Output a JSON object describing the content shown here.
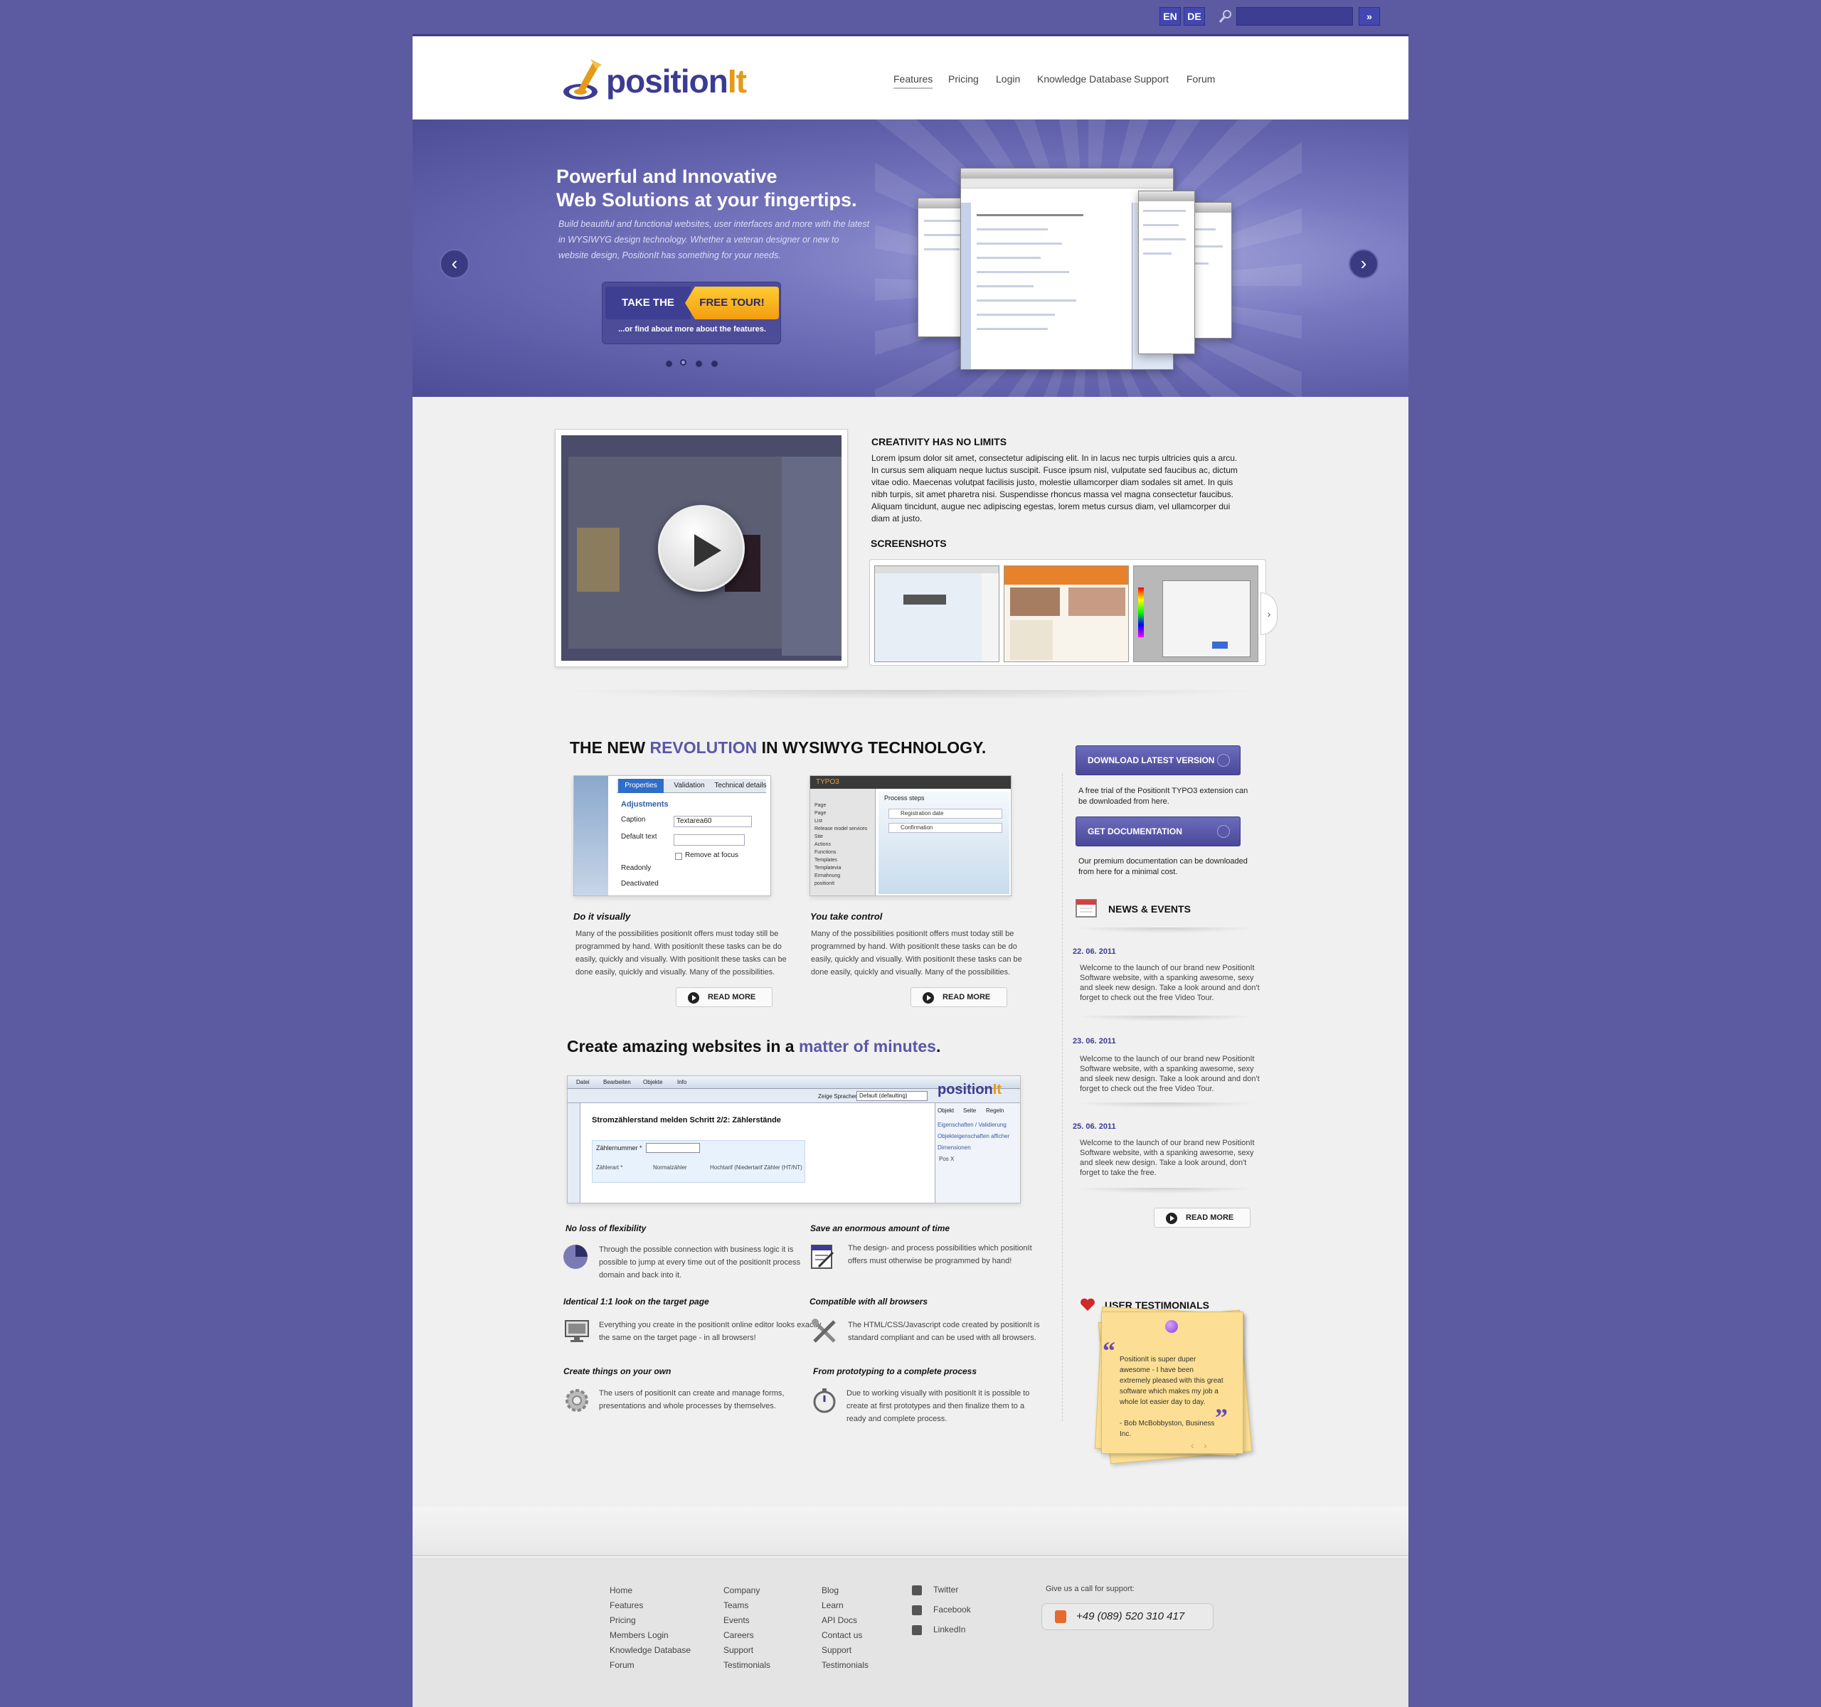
{
  "topbar": {
    "lang_en": "EN",
    "lang_de": "DE",
    "search_placeholder": "",
    "go": "»"
  },
  "logo": {
    "text_a": "position",
    "text_b": "It"
  },
  "nav": [
    "Features",
    "Pricing",
    "Login",
    "Knowledge Database",
    "Support",
    "Forum"
  ],
  "hero": {
    "title_1": "Powerful and Innovative",
    "title_2": "Web Solutions at your fingertips.",
    "text": "Build beautiful and functional websites, user interfaces and more with the latest in WYSIWYG design technology. Whether a veteran designer or new to website design, PositionIt has something for your needs.",
    "tour_left": "TAKE THE",
    "tour_right": "FREE TOUR!",
    "tour_sub": "...or find about more about the features.",
    "prev": "‹",
    "next": "›",
    "slides": 4,
    "active_slide": 2
  },
  "intro": {
    "heading": "CREATIVITY HAS NO LIMITS",
    "text": "Lorem ipsum dolor sit amet, consectetur adipiscing elit. In in lacus nec turpis ultricies quis a arcu. In cursus sem aliquam neque luctus suscipit. Fusce ipsum nisl, vulputate sed faucibus ac, dictum vitae odio. Maecenas volutpat facilisis justo, molestie ullamcorper diam sodales sit amet. In quis nibh turpis, sit amet pharetra nisi. Suspendisse rhoncus massa vel magna consectetur faucibus. Aliquam tincidunt, augue nec adipiscing egestas, lorem metus cursus diam, vel ullamcorper dui diam at justo.",
    "screens_heading": "SCREENSHOTS"
  },
  "revolution": {
    "title_a": "THE NEW ",
    "title_hl": "REVOLUTION",
    "title_b": " IN WYSIWYG TECHNOLOGY.",
    "col1": {
      "title": "Do it visually",
      "text": "Many of the possibilities positionIt offers must today still be programmed by hand. With positionIt these tasks can be do easily, quickly and visually. With positionIt these tasks can be done easily, quickly and visually. Many of the possibilities.",
      "tabs": [
        "Properties",
        "Validation",
        "Technical details"
      ],
      "panel_title": "Adjustments",
      "fields": [
        "Caption",
        "Default text",
        "Readonly",
        "Deactivated"
      ],
      "caption_value": "Textarea60",
      "remove_focus": "Remove at focus"
    },
    "col2": {
      "title": "You take control",
      "text": "Many of the possibilities positionIt offers must today still be programmed by hand. With positionIt these tasks can be do easily, quickly and visually. With positionIt these tasks can be done easily, quickly and visually. Many of the possibilities.",
      "app": "TYPO3",
      "panel_title": "Process steps",
      "steps": [
        "Registration date",
        "Confirmation"
      ],
      "tree": [
        "Page",
        "Page",
        "List",
        "Release model services",
        "Site",
        "Actions",
        "Functions",
        "Templates",
        "Templatevia",
        "Ermahnung",
        "positionIt"
      ]
    },
    "readmore": "READ MORE"
  },
  "amazing": {
    "title_a": "Create amazing websites in a ",
    "title_hl": "matter of minutes",
    "title_b": ".",
    "editor": {
      "menu": [
        "Datei",
        "Bearbeiten",
        "Objekte",
        "Info"
      ],
      "lang_label": "Zeige Sprachen:",
      "lang_value": "Default (defaulting)",
      "heading": "Stromzählerstand melden Schritt 2/2: Zählerstände",
      "field1": "Zählernummer *",
      "field2": "Zählerart *",
      "opt1": "Normalzähler",
      "opt2": "Hochtarif (Niedertarif Zähler (HT/NT)",
      "tabs": [
        "Objekt",
        "Seite",
        "Regeln"
      ],
      "side1": "Eigenschaften / Validierung",
      "side2": "Objekteigenschaften afficher",
      "side3": "Dimensionen",
      "pos_label": "Pos X"
    },
    "features": [
      {
        "title": "No loss of flexibility",
        "text": "Through the possible connection with business logic it is possible to jump at every time out of the positionIt process domain and back into it.",
        "icon": "pie-chart-icon"
      },
      {
        "title": "Save an enormous amount of time",
        "text": "The design- and process possibilities which positionIt offers  must otherwise be programmed by hand!",
        "icon": "document-edit-icon"
      },
      {
        "title": "Identical 1:1 look on the target page",
        "text": "Everything you create in the positionIt online editor looks exactly the same on the target page - in all browsers!",
        "icon": "monitor-icon"
      },
      {
        "title": "Compatible with all browsers",
        "text": "The HTML/CSS/Javascript code created by positionIt is standard compliant and can be used with all browsers.",
        "icon": "tools-icon"
      },
      {
        "title": "Create things on your own",
        "text": "The users of positionIt can create and manage forms, presentations and whole processes by themselves.",
        "icon": "gear-icon"
      },
      {
        "title": "From prototyping to a complete process",
        "text": "Due to working visually with positionIt it is possible to create at first prototypes and then finalize them to a ready and complete process.",
        "icon": "stopwatch-icon"
      }
    ]
  },
  "sidebar": {
    "download_btn": "DOWNLOAD LATEST VERSION",
    "download_text": "A free trial of the PositionIt TYPO3 extension can be downloaded from here.",
    "docs_btn": "GET DOCUMENTATION",
    "docs_text": "Our premium documentation can be downloaded from here for a minimal cost.",
    "news_heading": "NEWS & EVENTS",
    "news": [
      {
        "date": "22. 06. 2011",
        "text": "Welcome to the launch of our brand new PositionIt Software website, with a spanking awesome, sexy and sleek new design. Take a look around and don't forget to check out the free Video Tour."
      },
      {
        "date": "23. 06. 2011",
        "text": "Welcome to the launch of our brand new PositionIt Software website, with a spanking awesome, sexy and sleek new design. Take a look around and don't forget to check out the free Video Tour."
      },
      {
        "date": "25. 06. 2011",
        "text": "Welcome to the launch of our brand new PositionIt Software website, with a spanking awesome, sexy and sleek new design. Take a look around, don't forget to take the free."
      }
    ],
    "readmore": "READ MORE",
    "testimonials_heading": "USER TESTIMONIALS",
    "testimonial": "PositionIt is super duper awesome - I have been extremely pleased with this great software which makes my job a whole lot easier day to day.",
    "testimonial_author": "- Bob McBobbyston, Business Inc."
  },
  "footer": {
    "col1": [
      "Home",
      "Features",
      "Pricing",
      "Members Login",
      "Knowledge Database",
      "Forum"
    ],
    "col2": [
      "Company",
      "Teams",
      "Events",
      "Careers",
      "Support",
      "Testimonials"
    ],
    "col3": [
      "Blog",
      "Learn",
      "API Docs",
      "Contact us",
      "Support",
      "Testimonials"
    ],
    "social": [
      "Twitter",
      "Facebook",
      "LinkedIn"
    ],
    "support_text": "Give us a call for support:",
    "phone": "+49 (089) 520 310 417"
  }
}
